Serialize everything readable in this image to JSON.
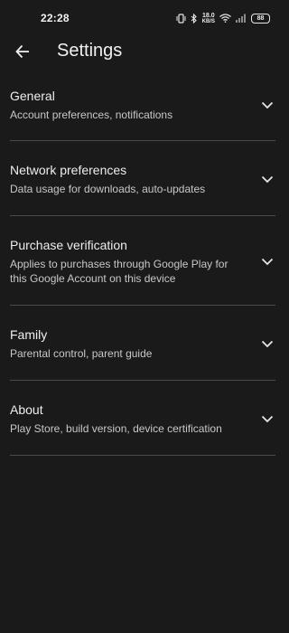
{
  "status_bar": {
    "time": "22:28",
    "net_speed_value": "18.0",
    "net_speed_unit": "KB/S",
    "battery": "88"
  },
  "app_bar": {
    "title": "Settings"
  },
  "settings": [
    {
      "title": "General",
      "subtitle": "Account preferences, notifications"
    },
    {
      "title": "Network preferences",
      "subtitle": "Data usage for downloads, auto-updates"
    },
    {
      "title": "Purchase verification",
      "subtitle": "Applies to purchases through Google Play for this Google Account on this device"
    },
    {
      "title": "Family",
      "subtitle": "Parental control, parent guide"
    },
    {
      "title": "About",
      "subtitle": "Play Store, build version, device certification"
    }
  ],
  "colors": {
    "background": "#1a1a1a",
    "divider": "#4a4a4a",
    "text_primary": "#eeeeee",
    "text_secondary": "#c8c8c8"
  },
  "icons": {
    "back": "arrow-back-icon",
    "expand": "chevron-down-icon"
  }
}
